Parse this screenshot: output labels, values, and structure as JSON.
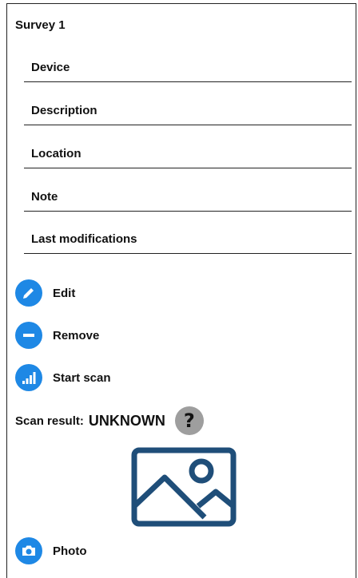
{
  "survey": {
    "title": "Survey 1"
  },
  "fields": [
    {
      "label": "Device"
    },
    {
      "label": "Description"
    },
    {
      "label": "Location"
    },
    {
      "label": "Note"
    },
    {
      "label": "Last modifications"
    }
  ],
  "actions": {
    "edit": "Edit",
    "remove": "Remove",
    "start_scan": "Start scan",
    "photo": "Photo"
  },
  "scan": {
    "label": "Scan result:",
    "value": "UNKNOWN",
    "status_icon": "question-icon",
    "status_symbol": "?"
  },
  "icons": {
    "edit": "pencil-icon",
    "remove": "minus-icon",
    "start_scan": "signal-bars-icon",
    "photo": "camera-icon",
    "image": "image-placeholder-icon"
  },
  "colors": {
    "accent": "#1e88e5",
    "image_icon": "#1f4e79",
    "status_unknown": "#9e9e9e"
  }
}
